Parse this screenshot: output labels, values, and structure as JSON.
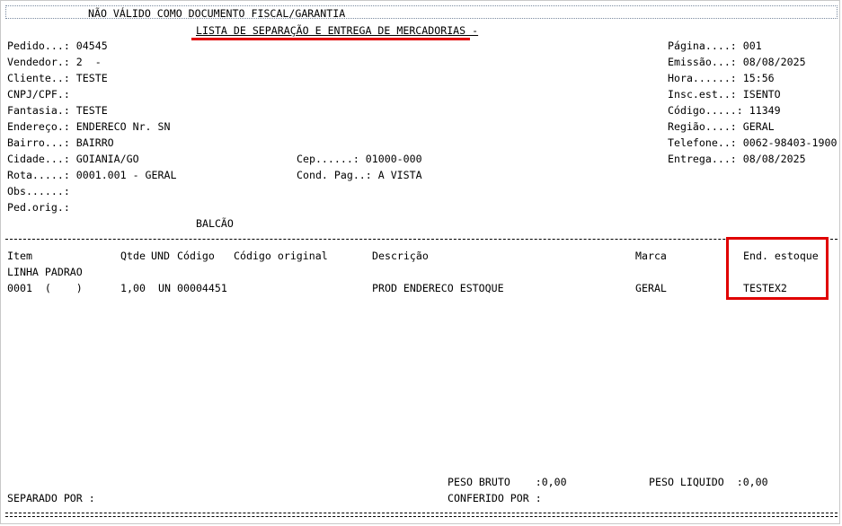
{
  "header": {
    "notice": "NÃO VÁLIDO COMO DOCUMENTO FISCAL/GARANTIA",
    "title": "LISTA DE SEPARAÇÃO E ENTREGA DE MERCADORIAS -"
  },
  "left_fields": {
    "pedido": "Pedido...: 04545",
    "vendedor": "Vendedor.: 2  -",
    "cliente": "Cliente..: TESTE",
    "cnpj": "CNPJ/CPF.:",
    "fantasia": "Fantasia.: TESTE",
    "endereco": "Endereço.: ENDERECO Nr. SN",
    "bairro": "Bairro...: BAIRRO",
    "cidade": "Cidade...: GOIANIA/GO",
    "rota": "Rota.....: 0001.001 - GERAL",
    "obs": "Obs......:",
    "ped_orig": "Ped.orig.:"
  },
  "middle_fields": {
    "cep": "Cep......: 01000-000",
    "cond_pag": "Cond. Pag..: A VISTA",
    "balcao": "BALCÃO"
  },
  "right_fields": {
    "pagina": "Página....: 001",
    "emissao": "Emissão...: 08/08/2025",
    "hora": "Hora......: 15:56",
    "insc_est": "Insc.est..: ISENTO",
    "codigo": "Código.....: 11349",
    "regiao": "Região....: GERAL",
    "telefone": "Telefone..: 0062-98403-1900",
    "entrega": "Entrega...: 08/08/2025"
  },
  "table": {
    "headers": {
      "item": "Item",
      "qtde": "Qtde",
      "und": "UND",
      "codigo": "Código",
      "codigo_original": "Código original",
      "descricao": "Descrição",
      "marca": "Marca",
      "end_estoque": "End. estoque"
    },
    "group": "LINHA PADRAO",
    "rows": [
      {
        "item": "0001  (    )",
        "qtde": "1,00",
        "und": "UN",
        "codigo": "00004451",
        "descricao": "PROD ENDERECO ESTOQUE",
        "marca": "GERAL",
        "end_estoque": "TESTEX2"
      }
    ]
  },
  "footer": {
    "peso_bruto": "PESO BRUTO    :0,00",
    "peso_liquido": "PESO LIQUIDO  :0,00",
    "separado_por": "SEPARADO POR :",
    "conferido_por": "CONFERIDO POR :"
  }
}
